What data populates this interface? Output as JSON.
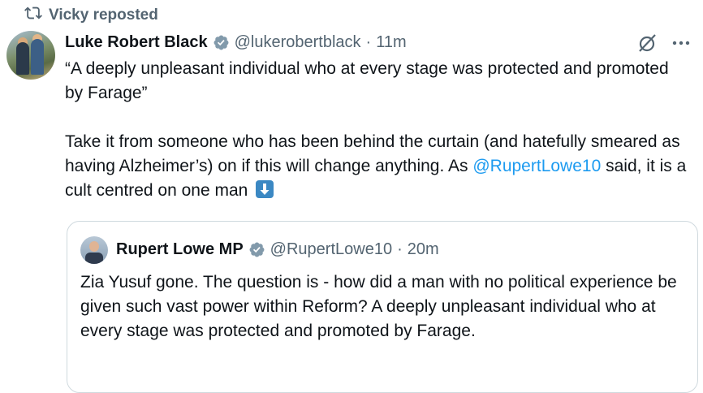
{
  "repost": {
    "label": "Vicky reposted",
    "icon": "repost-icon"
  },
  "tweet": {
    "author_name": "Luke Robert Black",
    "handle": "@lukerobertblack",
    "separator": "·",
    "time": "11m",
    "text_line1": "“A deeply unpleasant individual who at every stage was protected and promoted by Farage”",
    "text_line2_before": "Take it from someone who has been behind the curtain (and hatefully smeared as having Alzheimer’s) on if this will change anything. As ",
    "mention": "@RupertLowe10",
    "text_line2_after": " said, it is a cult centred on one man "
  },
  "quote": {
    "author_name": "Rupert Lowe MP",
    "handle": "@RupertLowe10",
    "separator": "·",
    "time": "20m",
    "text": "Zia Yusuf gone. The question is - how did a man with no political experience be given such vast power within Reform? A deeply unpleasant individual who at every stage was protected and promoted by Farage."
  },
  "colors": {
    "accent": "#1d9bf0",
    "muted": "#536471",
    "verified_badge": "#829aab",
    "border": "#cfd9de"
  },
  "icons": [
    "repost-icon",
    "verified-badge-icon",
    "grok-icon",
    "more-icon",
    "down-arrow-emoji"
  ]
}
